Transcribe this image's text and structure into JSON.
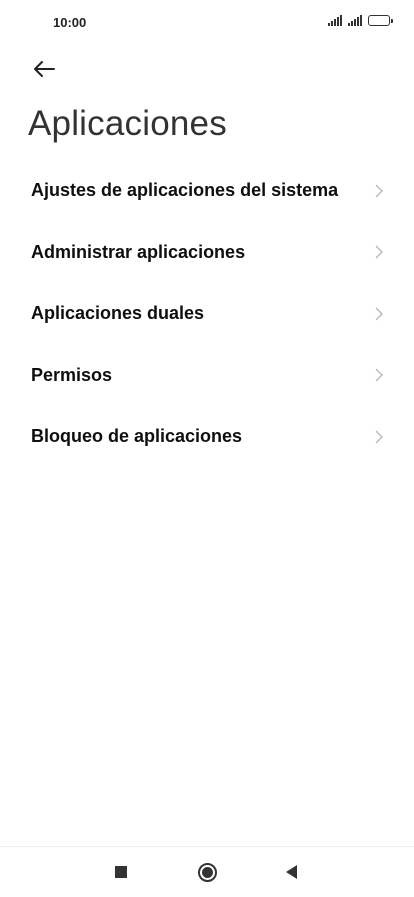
{
  "status_bar": {
    "time": "10:00",
    "signal_icons": [
      "signal-icon",
      "signal-icon"
    ],
    "battery_icon": "battery-icon"
  },
  "header": {
    "back_icon": "arrow-left-icon",
    "title": "Aplicaciones"
  },
  "settings": {
    "items": [
      {
        "label": "Ajustes de aplicaciones del sistema",
        "icon": "chevron-right-icon"
      },
      {
        "label": "Administrar aplicaciones",
        "icon": "chevron-right-icon"
      },
      {
        "label": "Aplicaciones duales",
        "icon": "chevron-right-icon"
      },
      {
        "label": "Permisos",
        "icon": "chevron-right-icon"
      },
      {
        "label": "Bloqueo de aplicaciones",
        "icon": "chevron-right-icon"
      }
    ]
  },
  "nav_bar": {
    "recents_icon": "square-icon",
    "home_icon": "circle-icon",
    "back_icon": "triangle-back-icon"
  },
  "colors": {
    "background": "#ffffff",
    "text_primary": "#0f0f0f",
    "title": "#333333",
    "chevron": "#b8b8b8"
  }
}
